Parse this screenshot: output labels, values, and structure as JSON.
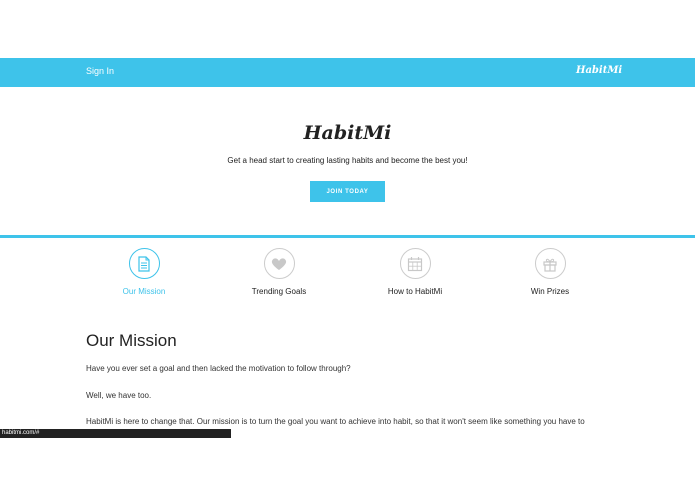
{
  "navbar": {
    "signin_label": "Sign In",
    "logo_text": "HabitMi",
    "color": "#3ec3ea"
  },
  "hero": {
    "logo_text": "HabitMi",
    "tagline": "Get a head start to creating lasting habits and become the best you!",
    "join_label": "JOIN TODAY"
  },
  "tabs": [
    {
      "label": "Our Mission",
      "icon": "document-icon",
      "active": true
    },
    {
      "label": "Trending Goals",
      "icon": "heart-icon",
      "active": false
    },
    {
      "label": "How to HabitMi",
      "icon": "calendar-icon",
      "active": false
    },
    {
      "label": "Win Prizes",
      "icon": "gift-icon",
      "active": false
    }
  ],
  "mission": {
    "title": "Our Mission",
    "paragraphs": [
      "Have you ever set a goal and then lacked the motivation to follow through?",
      "Well, we have too.",
      "HabitMi is here to change that. Our mission is to turn the goal you want to achieve into habit, so that it won't seem like something you have to"
    ]
  },
  "status_bar": {
    "url": "habitmi.com/#"
  }
}
